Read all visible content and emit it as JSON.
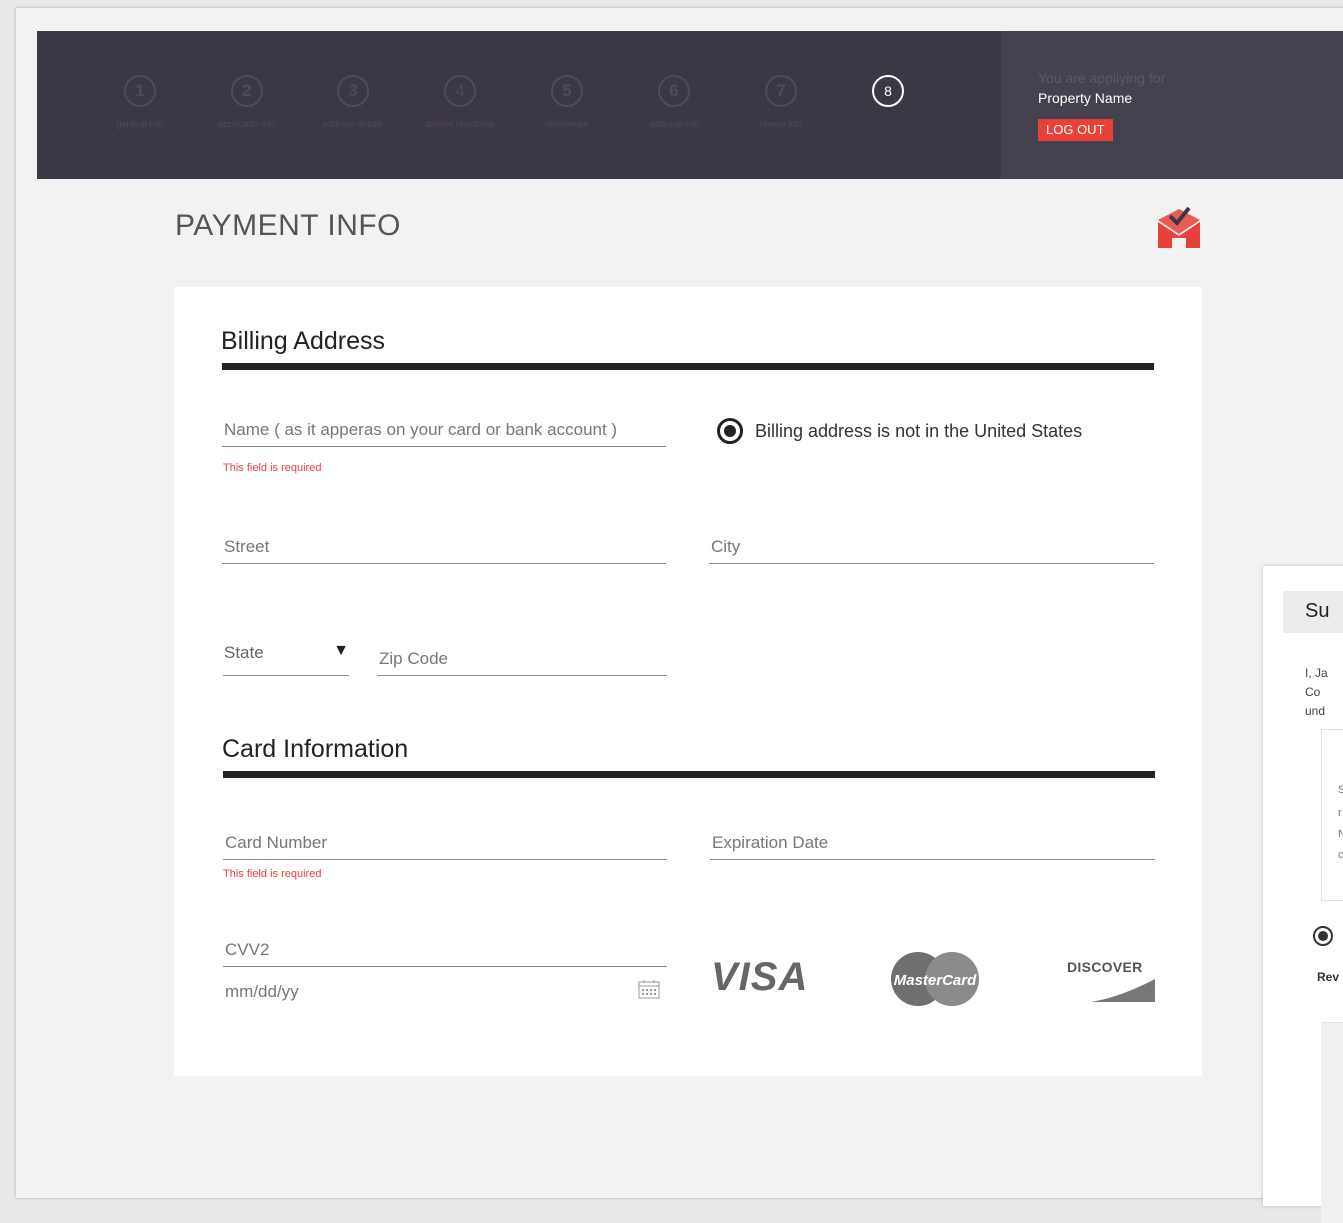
{
  "header": {
    "steps": [
      {
        "number": "1",
        "label": "general info"
      },
      {
        "number": "2",
        "label": "applicants info"
      },
      {
        "number": "3",
        "label": "address details"
      },
      {
        "number": "4",
        "label": "current residence"
      },
      {
        "number": "5",
        "label": "references"
      },
      {
        "number": "6",
        "label": "aditional info"
      },
      {
        "number": "7",
        "label": "review info"
      },
      {
        "number": "8",
        "label": ""
      }
    ],
    "active_step": 8,
    "applying_for": "You are appliying for",
    "property_name": "Property Name",
    "logout_label": "LOG OUT"
  },
  "page": {
    "title": "PAYMENT INFO",
    "logo_icon": "house-check-logo-icon"
  },
  "billing": {
    "title": "Billing Address",
    "name_placeholder": "Name ( as it apperas on your card or bank account )",
    "name_error": "This field is required",
    "non_us_label": "Billing address is not in the United States",
    "street_placeholder": "Street",
    "city_placeholder": "City",
    "state_value": "State",
    "zip_placeholder": "Zip Code"
  },
  "card": {
    "title": "Card Information",
    "number_placeholder": "Card Number",
    "number_error": "This field is required",
    "expiration_placeholder": "Expiration Date",
    "cvv_placeholder": "CVV2",
    "date_placeholder": "mm/dd/yy",
    "brands": [
      "VISA",
      "MasterCard",
      "DISCOVER"
    ]
  },
  "side_panel": {
    "title": "Su",
    "lines": [
      "I, Ja",
      "Co",
      "und"
    ],
    "box_lines": [
      "S",
      "r",
      "N",
      "c"
    ],
    "review_label": "Rev"
  },
  "colors": {
    "header_bg": "#3c3744",
    "accent": "#e8413a",
    "text_dark": "#222222"
  }
}
